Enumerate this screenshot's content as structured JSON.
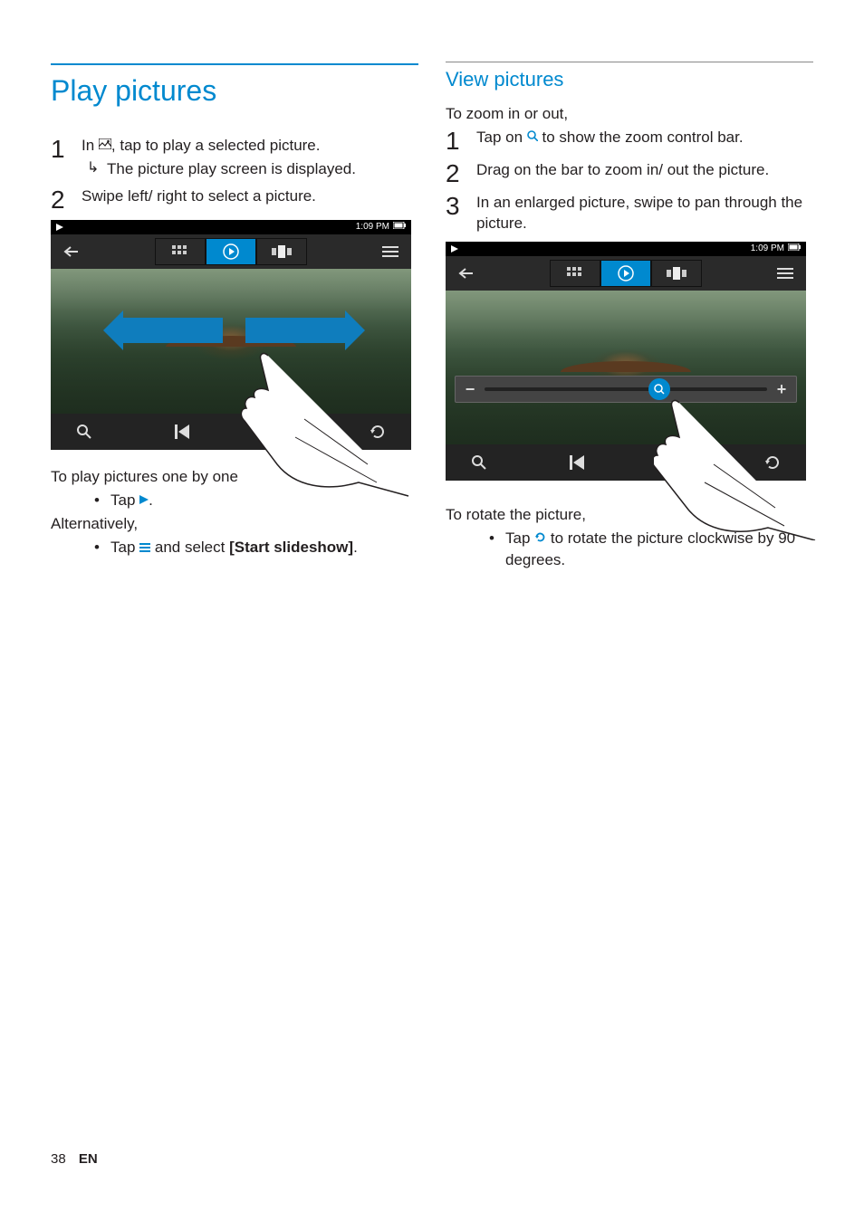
{
  "page_number": "38",
  "lang_code": "EN",
  "left": {
    "heading": "Play pictures",
    "step1_prefix": "In ",
    "step1_suffix": ", tap to play a selected picture.",
    "step1_sub": "The picture play screen is displayed.",
    "step2": "Swipe left/ right to select a picture.",
    "play_one_heading": "To play pictures one by one",
    "play_one_bullet_pre": "Tap ",
    "play_one_bullet_post": ".",
    "alt": "Alternatively,",
    "alt_bullet_pre": "Tap ",
    "alt_bullet_mid": " and select ",
    "alt_bullet_option": "[Start slideshow]",
    "alt_bullet_post": "."
  },
  "right": {
    "sub_heading": "View pictures",
    "zoom_heading": "To zoom in or out,",
    "zoom_step1_pre": "Tap on ",
    "zoom_step1_post": " to show the zoom control bar.",
    "zoom_step2": "Drag on the bar to zoom in/ out the picture.",
    "zoom_step3": "In an enlarged picture, swipe to pan through the picture.",
    "rotate_heading": "To rotate the picture,",
    "rotate_bullet_pre": "Tap ",
    "rotate_bullet_post": " to rotate the picture clockwise by 90 degrees."
  },
  "illus": {
    "time": "1:09 PM"
  },
  "nums": {
    "n1": "1",
    "n2": "2",
    "n3": "3"
  },
  "glyphs": {
    "bullet": "•"
  }
}
